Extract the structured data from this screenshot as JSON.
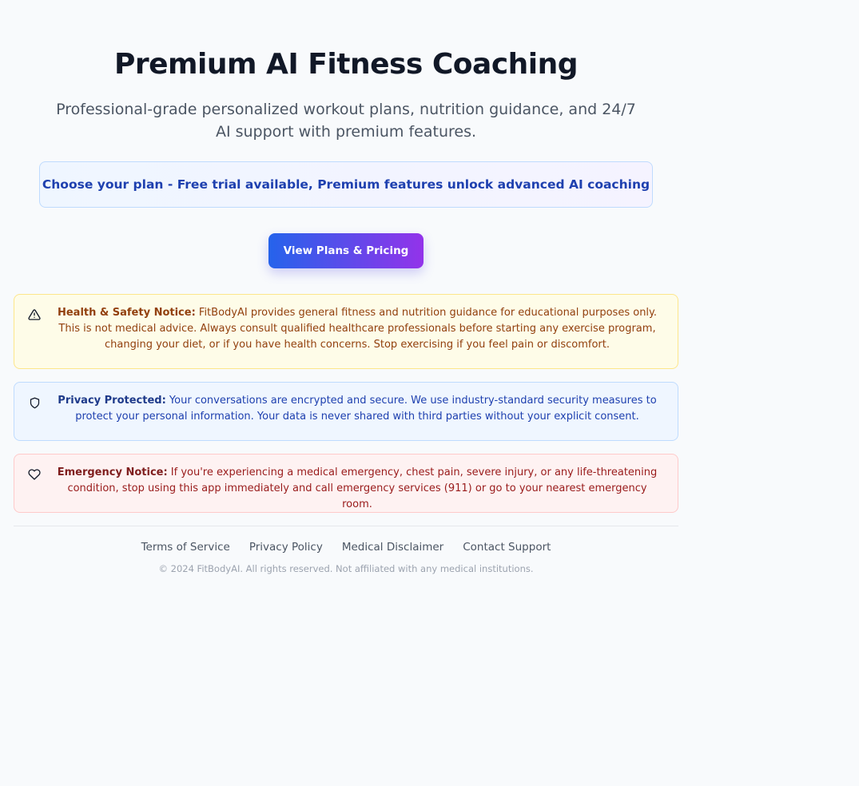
{
  "hero": {
    "title": "Premium AI Fitness Coaching",
    "subtitle": "Professional-grade personalized workout plans, nutrition guidance, and 24/7 AI support with premium features."
  },
  "plan_banner": {
    "text": "Choose your plan - Free trial available, Premium features unlock advanced AI coaching"
  },
  "cta": {
    "label": "View Plans & Pricing"
  },
  "notices": {
    "health": {
      "icon": "warning-triangle-icon",
      "heading": "Health & Safety Notice:",
      "body": " FitBodyAI provides general fitness and nutrition guidance for educational purposes only. This is not medical advice. Always consult qualified healthcare professionals before starting any exercise program, changing your diet, or if you have health concerns. Stop exercising if you feel pain or discomfort."
    },
    "privacy": {
      "icon": "shield-icon",
      "heading": "Privacy Protected:",
      "body": " Your conversations are encrypted and secure. We use industry-standard security measures to protect your personal information. Your data is never shared with third parties without your explicit consent."
    },
    "emergency": {
      "icon": "heart-icon",
      "heading": "Emergency Notice:",
      "body": " If you're experiencing a medical emergency, chest pain, severe injury, or any life-threatening condition, stop using this app immediately and call emergency services (911) or go to your nearest emergency room."
    }
  },
  "footer": {
    "links": [
      "Terms of Service",
      "Privacy Policy",
      "Medical Disclaimer",
      "Contact Support"
    ],
    "copyright": "© 2024 FitBodyAI. All rights reserved. Not affiliated with any medical institutions."
  },
  "colors": {
    "background": "#f8fafc",
    "cta_gradient_start": "#2563eb",
    "cta_gradient_end": "#9333ea",
    "health_text": "#92400e",
    "privacy_text": "#1e40af",
    "emergency_text": "#991b1b"
  }
}
